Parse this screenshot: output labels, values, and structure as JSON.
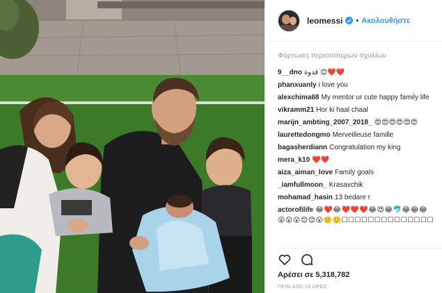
{
  "post": {
    "username": "leomessi",
    "follow_label": "Ακολουθήστε",
    "separator": "•",
    "verified_icon": "verified-badge-icon",
    "accent_color": "#3897f0"
  },
  "comments_section": {
    "load_more": "Φόρτωση περισσότερων σχολίων",
    "items": [
      {
        "user": "9__dno",
        "text": "قدوة 😊❤️❤️"
      },
      {
        "user": "phanxuanly",
        "text": "i love you"
      },
      {
        "user": "alexchima68",
        "text": "My mentor ur cute happy family life"
      },
      {
        "user": "vikramm21",
        "text": "Hor ki haal chaal"
      },
      {
        "user": "marijn_ambting_2007_2018_",
        "text": "😍😍😍😍😍😍"
      },
      {
        "user": "laurettedongmo",
        "text": "Merveilleuse famille"
      },
      {
        "user": "bagasherdiann",
        "text": "Congratulation my king"
      },
      {
        "user": "mera_k10",
        "text": "❤️❤️"
      },
      {
        "user": "aiza_aiman_love",
        "text": "Family goals"
      },
      {
        "user": "_iamfullmoon_",
        "text": "Krasavchik"
      },
      {
        "user": "mohamad_hasin",
        "text": "13 bedare r"
      },
      {
        "user": "actorofilife",
        "text": "😂❤️😂❤️❤️❤️😂😍😂🐬😂😂😂😮😮😮😊😊😮🙂🙂☐☐☐☐☐☐☐☐☐☐☐☐☐☐☐☐☐☐☐☐☐☐☐☐"
      }
    ]
  },
  "actions": {
    "like_icon": "heart-icon",
    "comment_icon": "comment-bubble-icon"
  },
  "likes_text": "Αρέσει σε 5,318,782",
  "timestamp": "ΠΡΙΝ ΑΠΟ 18 ΩΡΕΣ"
}
